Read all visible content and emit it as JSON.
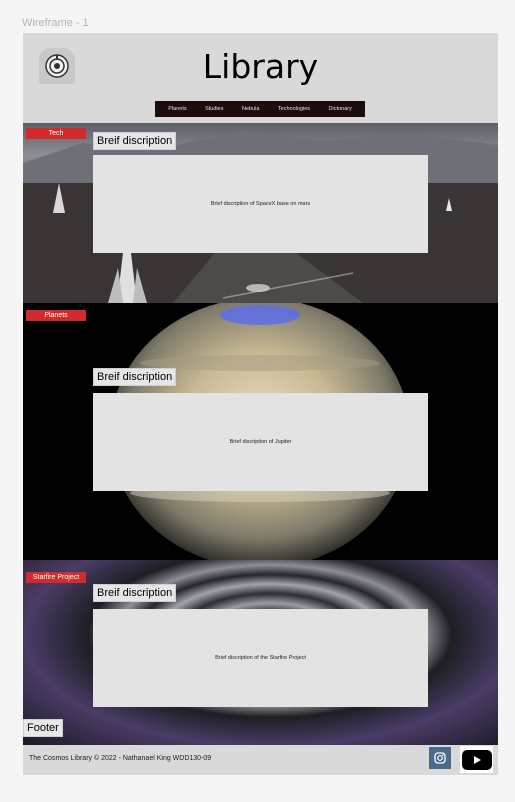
{
  "frame_label": "Wireframe - 1",
  "header": {
    "title": "Library",
    "logo_icon": "astronaut-helmet-logo-icon"
  },
  "nav": {
    "items": [
      "Planets",
      "Studies",
      "Nebula",
      "Technologies",
      "Dictonary"
    ]
  },
  "sections": [
    {
      "tag": "Tech",
      "heading": "Breif discription",
      "description": "Brief discription of SpaceX base on mars"
    },
    {
      "tag": "Planets",
      "heading": "Breif discription",
      "description": "Brief discription of Jupiter"
    },
    {
      "tag": "Starfire Project",
      "heading": "Breif discription",
      "description": "Brief discription of the Starfire Project"
    }
  ],
  "footer": {
    "label": "Footer",
    "copyright": "The Cosmos Library © 2022 - Nathanael King WDD130-09",
    "icons": [
      "instagram-icon",
      "youtube-icon"
    ]
  },
  "colors": {
    "tag_red": "#d32b2b",
    "nav_bg": "#1c0c0c",
    "frame_bg": "#d9d9d9"
  }
}
